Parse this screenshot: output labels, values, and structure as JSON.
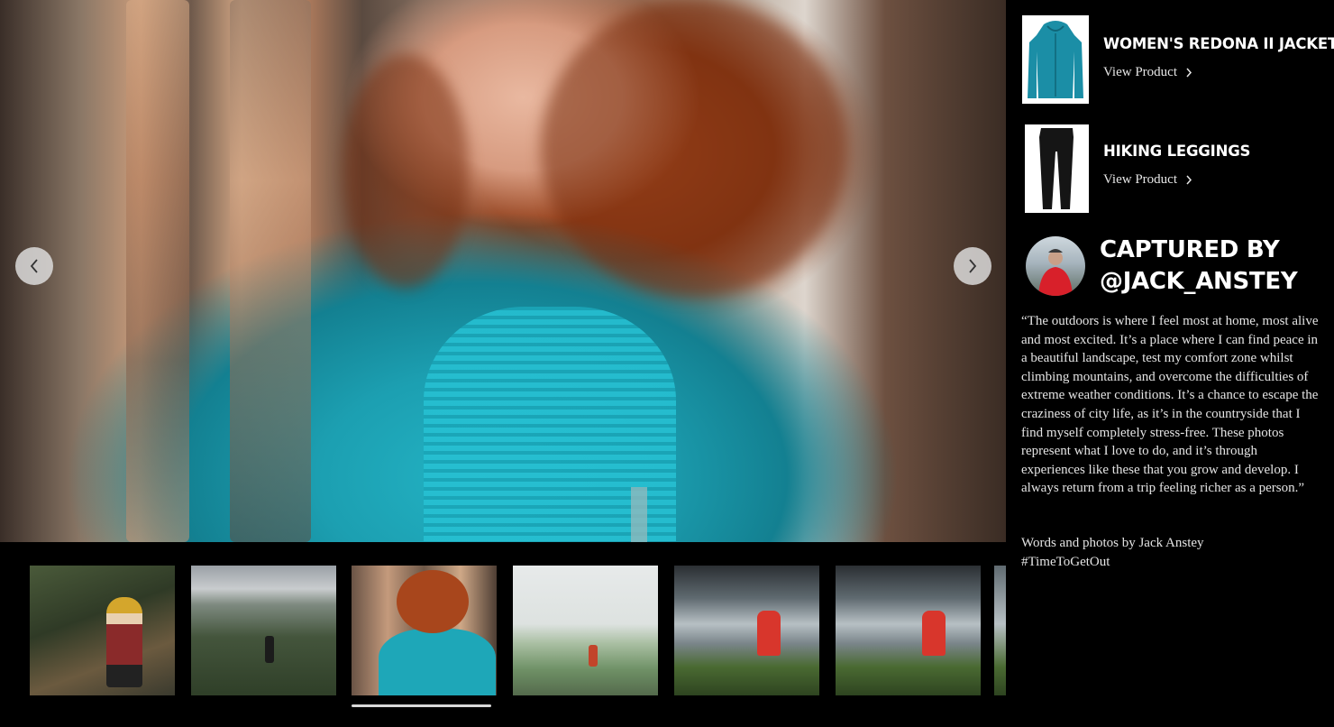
{
  "gallery": {
    "prev_label": "Previous image",
    "next_label": "Next image",
    "thumbnails": [
      {
        "subject": "woman in yellow beanie sitting in forest"
      },
      {
        "subject": "hiker standing above green valley"
      },
      {
        "subject": "woman in teal hoodie by tree"
      },
      {
        "subject": "hiker near stone wall in misty field"
      },
      {
        "subject": "person in red jacket by the sea"
      },
      {
        "subject": "person in red jacket by the sea"
      },
      {
        "subject": "partial next thumbnail"
      }
    ],
    "active_index": 2
  },
  "products": [
    {
      "name": "WOMEN'S REDONA II JACKET",
      "link_label": "View Product",
      "image": "teal-hoodie-icon"
    },
    {
      "name": "HIKING LEGGINGS",
      "link_label": "View Product",
      "image": "black-leggings-icon"
    }
  ],
  "author": {
    "line1": "CAPTURED BY",
    "line2": "@JACK_ANSTEY"
  },
  "quote": "“The outdoors is where I feel most at home, most alive and most excited. It’s a place where I can find peace in a beautiful landscape, test my comfort zone whilst climbing mountains, and overcome the difficulties of extreme weather conditions. It’s a chance to escape the craziness of city life, as it’s in the countryside that I find myself completely stress-free. These photos represent what I love to do, and it’s through experiences like these that you grow and develop. I always return from a trip feeling richer as a person.”",
  "credit": {
    "line1": "Words and photos by Jack Anstey",
    "line2": "#TimeToGetOut"
  },
  "colors": {
    "background": "#000000",
    "jacket_teal": "#1ea7b8",
    "active_indicator": "#d8d8d8"
  }
}
